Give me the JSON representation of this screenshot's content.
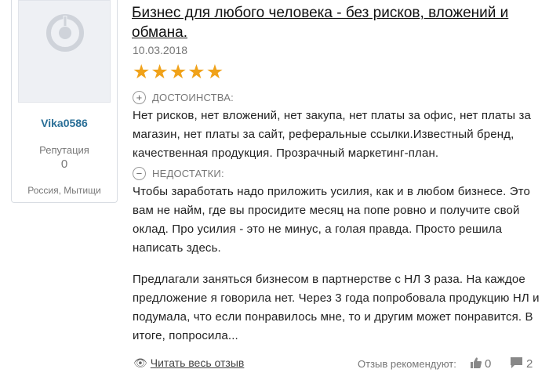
{
  "user": {
    "name": "Vika0586",
    "reputation_label": "Репутация",
    "reputation_value": "0",
    "location": "Россия, Мытищи"
  },
  "review": {
    "title": "Бизнес для любого человека - без рисков, вложений и обмана.",
    "date": "10.03.2018",
    "rating": 5,
    "rating_max": 5,
    "pros_label": "ДОСТОИНСТВА:",
    "pros_text": "Нет рисков, нет вложений, нет закупа, нет платы за офис, нет платы за магазин, нет платы за сайт, реферальные ссылки.Известный бренд, качественная продукция. Прозрачный маркетинг-план.",
    "cons_label": "НЕДОСТАТКИ:",
    "cons_text": "Чтобы заработать надо приложить усилия, как и в любом бизнесе. Это вам не найм, где вы просидите месяц на попе ровно и получите свой оклад. Про усилия - это не минус, а голая правда. Просто решила написать здесь.",
    "body_excerpt": "Предлагали заняться бизнесом в партнерстве с НЛ 3 раза. На каждое предложение я говорила нет. Через 3 года попробовала продукцию НЛ и подумала, что если понравилось мне, то и другим может понравится. В итоге, попросила..."
  },
  "footer": {
    "read_all_label": "Читать весь отзыв",
    "recommend_label": "Отзыв рекомендуют:",
    "likes": "0",
    "comments": "2"
  },
  "colors": {
    "star": "#f0a21a",
    "username": "#2a6f97",
    "muted": "#777777"
  },
  "icons": {
    "avatar": "default-avatar-icon",
    "pros": "plus-circle-icon",
    "cons": "minus-circle-icon",
    "read": "eye-icon",
    "like": "thumbs-up-icon",
    "comment": "comment-icon"
  }
}
